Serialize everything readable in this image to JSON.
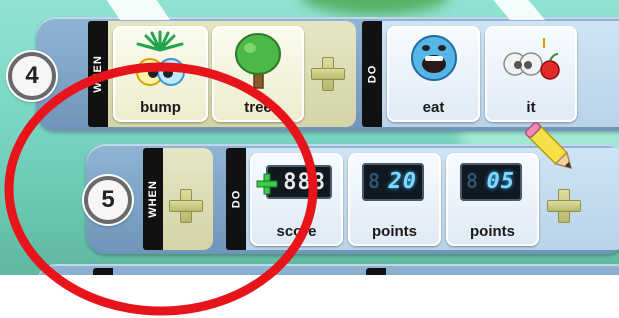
{
  "program": {
    "rows": [
      {
        "number": "4",
        "when": {
          "label": "WHEN",
          "tiles": [
            {
              "label": "bump",
              "icon": "bump-eyes-icon"
            },
            {
              "label": "tree",
              "icon": "tree-icon"
            }
          ]
        },
        "do": {
          "label": "DO",
          "tiles": [
            {
              "label": "eat",
              "icon": "eating-face-icon"
            },
            {
              "label": "it",
              "icon": "it-apple-icon"
            }
          ]
        }
      },
      {
        "number": "5",
        "when": {
          "label": "WHEN",
          "tiles": []
        },
        "do": {
          "label": "DO",
          "tiles": [
            {
              "label": "score",
              "icon": "score-display-icon",
              "display": "888"
            },
            {
              "label": "points",
              "icon": "lcd-number-icon",
              "display": "20",
              "ghost": "8"
            },
            {
              "label": "points",
              "icon": "lcd-number-icon",
              "display": "05",
              "ghost": "8"
            }
          ]
        }
      }
    ]
  },
  "colors": {
    "annotation_circle": "#e8141c",
    "row_background": "#7fa3c5",
    "when_panel": "#dcdcb3",
    "do_panel": "#c5dcee",
    "lcd_digits": "#7fd8ff"
  }
}
